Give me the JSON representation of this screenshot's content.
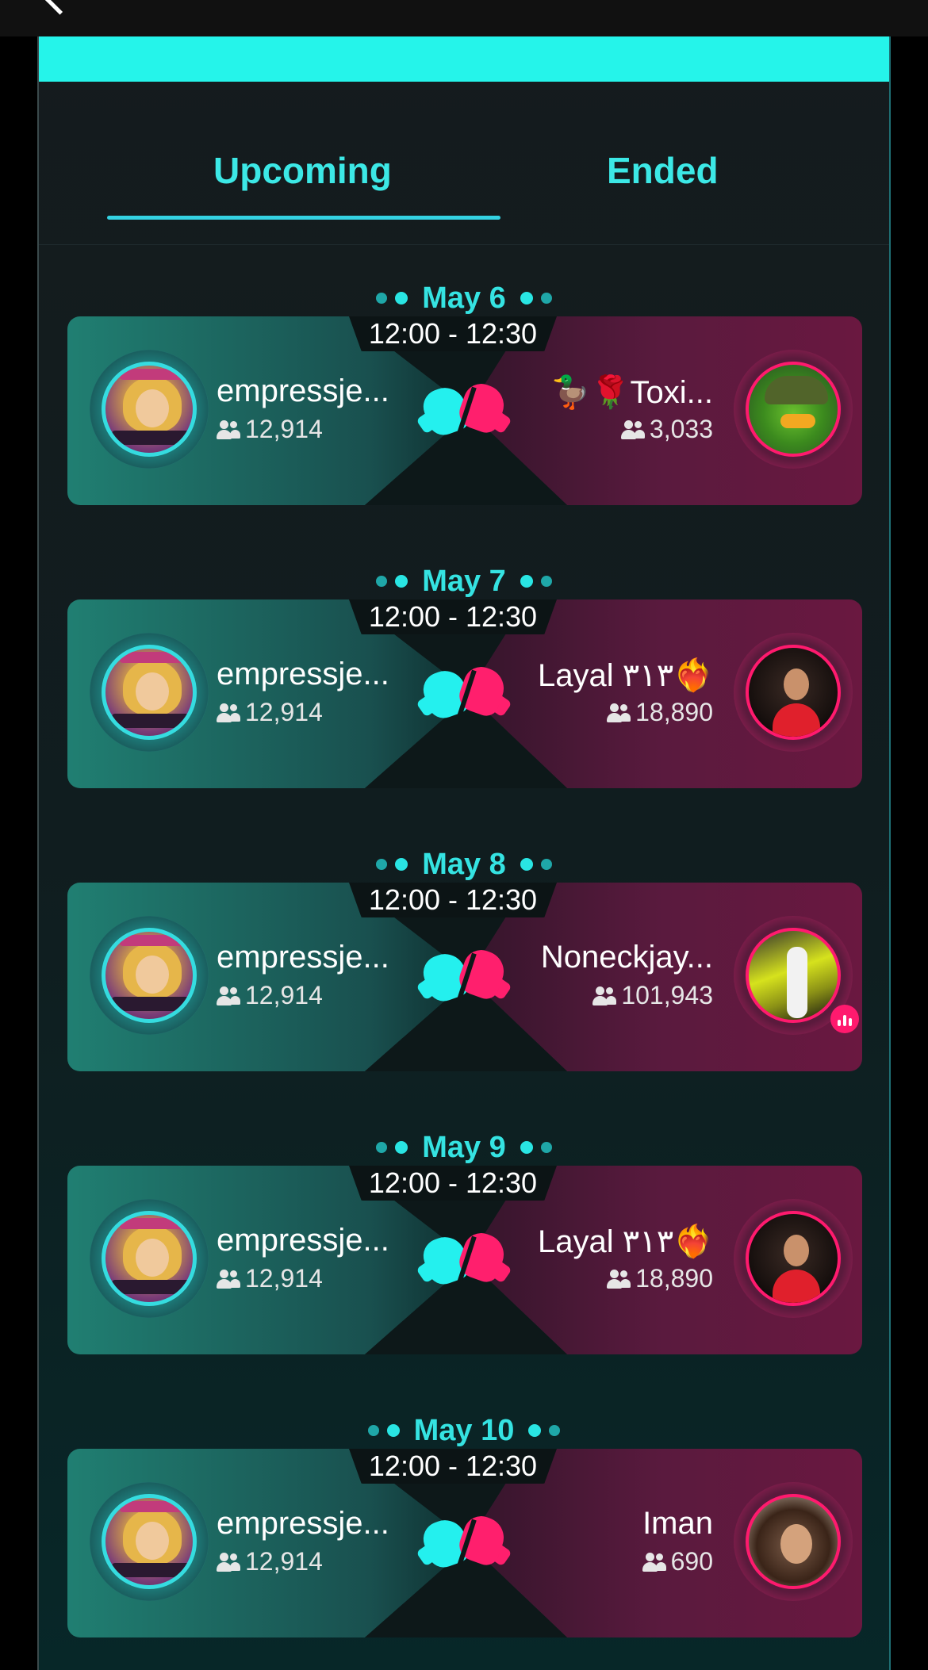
{
  "tabs": {
    "upcoming": "Upcoming",
    "ended": "Ended",
    "active": "Upcoming"
  },
  "colors": {
    "accent": "#25f4ea",
    "pink": "#ff1a6e",
    "teal": "#35e3e2"
  },
  "battles": [
    {
      "date": "May 6",
      "time": "12:00 - 12:30",
      "left": {
        "name": "empressje...",
        "followers": "12,914",
        "avatar": "empress-avatar"
      },
      "right": {
        "name": "🦆🌹Toxi...",
        "followers": "3,033",
        "avatar": "duck-avatar"
      }
    },
    {
      "date": "May 7",
      "time": "12:00 - 12:30",
      "left": {
        "name": "empressje...",
        "followers": "12,914",
        "avatar": "empress-avatar"
      },
      "right": {
        "name": "Layal ٣١٣❤️‍🔥",
        "followers": "18,890",
        "avatar": "layal-avatar"
      }
    },
    {
      "date": "May 8",
      "time": "12:00 - 12:30",
      "left": {
        "name": "empressje...",
        "followers": "12,914",
        "avatar": "empress-avatar"
      },
      "right": {
        "name": "Noneckjay...",
        "followers": "101,943",
        "avatar": "car-avatar",
        "live": true
      }
    },
    {
      "date": "May 9",
      "time": "12:00 - 12:30",
      "left": {
        "name": "empressje...",
        "followers": "12,914",
        "avatar": "empress-avatar"
      },
      "right": {
        "name": "Layal ٣١٣❤️‍🔥",
        "followers": "18,890",
        "avatar": "layal-avatar"
      }
    },
    {
      "date": "May 10",
      "time": "12:00 - 12:30",
      "left": {
        "name": "empressje...",
        "followers": "12,914",
        "avatar": "empress-avatar"
      },
      "right": {
        "name": "Iman",
        "followers": "690",
        "avatar": "curly-avatar"
      }
    }
  ]
}
